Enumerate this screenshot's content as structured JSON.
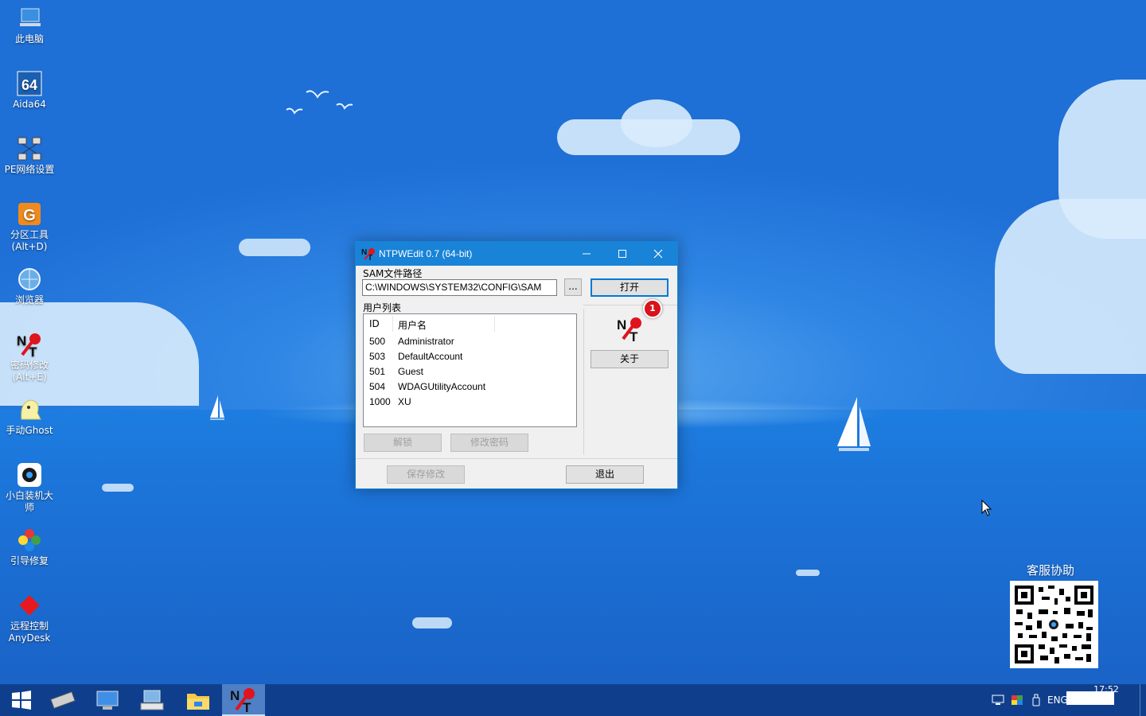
{
  "desktop_icons": [
    {
      "label": "此电脑",
      "icon": "computer-icon"
    },
    {
      "label": "Aida64",
      "icon": "aida64-icon"
    },
    {
      "label": "PE网络设置",
      "icon": "network-settings-icon"
    },
    {
      "label": "分区工具\n(Alt+D)",
      "icon": "partition-tool-icon"
    },
    {
      "label": "浏览器",
      "icon": "browser-icon"
    },
    {
      "label": "密码修改\n(Alt+E)",
      "icon": "ntpwedit-icon"
    },
    {
      "label": "手动Ghost",
      "icon": "ghost-icon"
    },
    {
      "label": "小白装机大\n师",
      "icon": "xiaobai-icon"
    },
    {
      "label": "引导修复",
      "icon": "boot-repair-icon"
    },
    {
      "label": "远程控制\nAnyDesk",
      "icon": "anydesk-icon"
    }
  ],
  "window": {
    "title": "NTPWEdit 0.7 (64-bit)",
    "sam_label": "SAM文件路径",
    "sam_path": "C:\\WINDOWS\\SYSTEM32\\CONFIG\\SAM",
    "browse_label": "...",
    "open_label": "打开",
    "badge": "1",
    "userlist_label": "用户列表",
    "columns": [
      "ID",
      "用户名"
    ],
    "users": [
      {
        "id": "500",
        "name": "Administrator"
      },
      {
        "id": "503",
        "name": "DefaultAccount"
      },
      {
        "id": "501",
        "name": "Guest"
      },
      {
        "id": "504",
        "name": "WDAGUtilityAccount"
      },
      {
        "id": "1000",
        "name": "XU"
      }
    ],
    "unlock_label": "解锁",
    "change_password_label": "修改密码",
    "about_label": "关于",
    "save_label": "保存修改",
    "exit_label": "退出"
  },
  "qr": {
    "title": "客服协助"
  },
  "taskbar": {
    "items": [
      "start-icon",
      "memory-icon",
      "remote-desktop-icon",
      "keyboard-icon",
      "file-explorer-icon",
      "ntpwedit-icon"
    ],
    "tray_lang": "ENG",
    "clock": "17:52"
  },
  "colors": {
    "accent": "#1883d7",
    "taskbar": "#0f3f8c",
    "badge": "#d9121c"
  }
}
